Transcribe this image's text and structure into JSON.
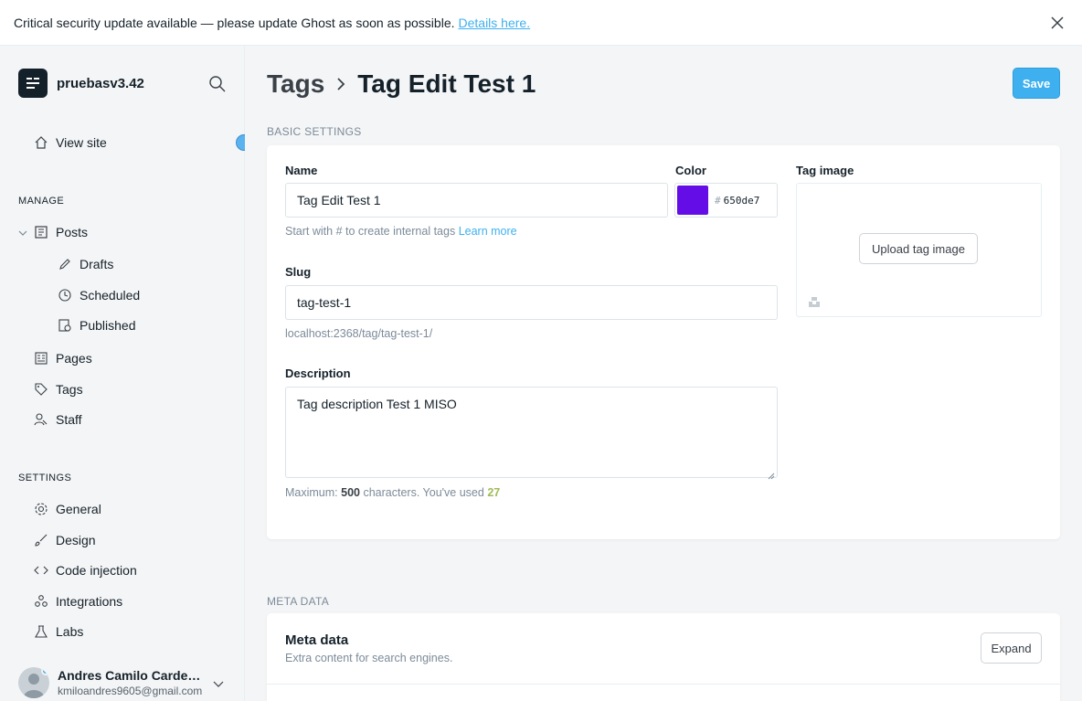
{
  "banner": {
    "text": "Critical security update available — please update Ghost as soon as possible.",
    "link": "Details here.",
    "close_icon": "close-icon"
  },
  "sidebar": {
    "site_name": "pruebasv3.42",
    "view_site": "View site",
    "manage_title": "MANAGE",
    "posts": "Posts",
    "drafts": "Drafts",
    "scheduled": "Scheduled",
    "published": "Published",
    "pages": "Pages",
    "tags": "Tags",
    "staff": "Staff",
    "settings_title": "SETTINGS",
    "general": "General",
    "design": "Design",
    "code_injection": "Code injection",
    "integrations": "Integrations",
    "labs": "Labs",
    "user": {
      "name": "Andres Camilo Cardenas",
      "email": "kmiloandres9605@gmail.com"
    }
  },
  "header": {
    "crumb_parent": "Tags",
    "crumb_current": "Tag Edit Test 1",
    "save_label": "Save"
  },
  "basic": {
    "section_label": "BASIC SETTINGS",
    "name_label": "Name",
    "name_value": "Tag Edit Test 1",
    "name_hint": "Start with # to create internal tags",
    "learn_more": "Learn more",
    "color_label": "Color",
    "color_hash": "#",
    "color_value": "650de7",
    "color_swatch": "#650de7",
    "image_label": "Tag image",
    "upload_label": "Upload tag image",
    "slug_label": "Slug",
    "slug_value": "tag-test-1",
    "slug_url": "localhost:2368/tag/tag-test-1/",
    "desc_label": "Description",
    "desc_value": "Tag description Test 1 MISO",
    "count_prefix": "Maximum:",
    "count_max": "500",
    "count_mid": "characters. You've used",
    "count_used": "27"
  },
  "meta": {
    "section_label": "META DATA",
    "title": "Meta data",
    "subtitle": "Extra content for search engines.",
    "expand_label": "Expand"
  },
  "colors": {
    "accent": "#3eb0ef",
    "used_count": "#9fbb58"
  }
}
